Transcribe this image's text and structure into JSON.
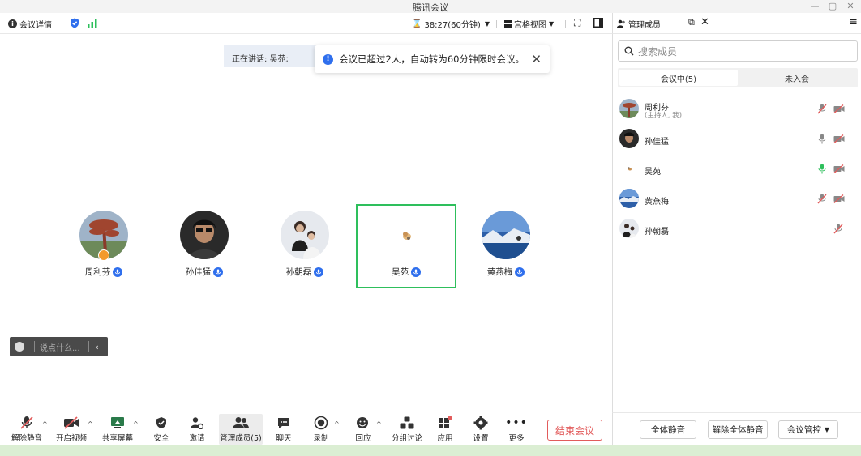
{
  "window": {
    "title": "腾讯会议"
  },
  "topbar": {
    "meeting_details": "会议详情",
    "timer": "38:27(60分钟)",
    "grid_view": "宫格视图",
    "members_tab": "管理成员"
  },
  "stage": {
    "speaking_label": "正在讲话: 吴苑;",
    "toast_message": "会议已超过2人，自动转为60分钟限时会议。",
    "chat_placeholder": "说点什么...",
    "participants": [
      {
        "name": "周利芬"
      },
      {
        "name": "孙佳猛"
      },
      {
        "name": "孙朝磊"
      },
      {
        "name": "吴苑"
      },
      {
        "name": "黄燕梅"
      }
    ]
  },
  "toolbar": {
    "unmute": "解除静音",
    "start_video": "开启视频",
    "share_screen": "共享屏幕",
    "security": "安全",
    "invite": "邀请",
    "manage_members": "管理成员(5)",
    "chat": "聊天",
    "record": "录制",
    "reactions": "回应",
    "breakout": "分组讨论",
    "apps": "应用",
    "settings": "设置",
    "more": "更多",
    "end_meeting": "结束会议"
  },
  "members_panel": {
    "search_placeholder": "搜索成员",
    "tab_in_meeting": "会议中(5)",
    "tab_not_joined": "未入会",
    "members": [
      {
        "name": "周利芬",
        "role": "(主持人, 我)"
      },
      {
        "name": "孙佳猛"
      },
      {
        "name": "吴苑"
      },
      {
        "name": "黄燕梅"
      },
      {
        "name": "孙朝磊"
      }
    ],
    "mute_all": "全体静音",
    "unmute_all": "解除全体静音",
    "meeting_control": "会议管控"
  },
  "colors": {
    "accent_blue": "#2f6fed",
    "active_green": "#2ebf5c",
    "end_red": "#e25b5b",
    "signal_green": "#2ebf5c"
  }
}
